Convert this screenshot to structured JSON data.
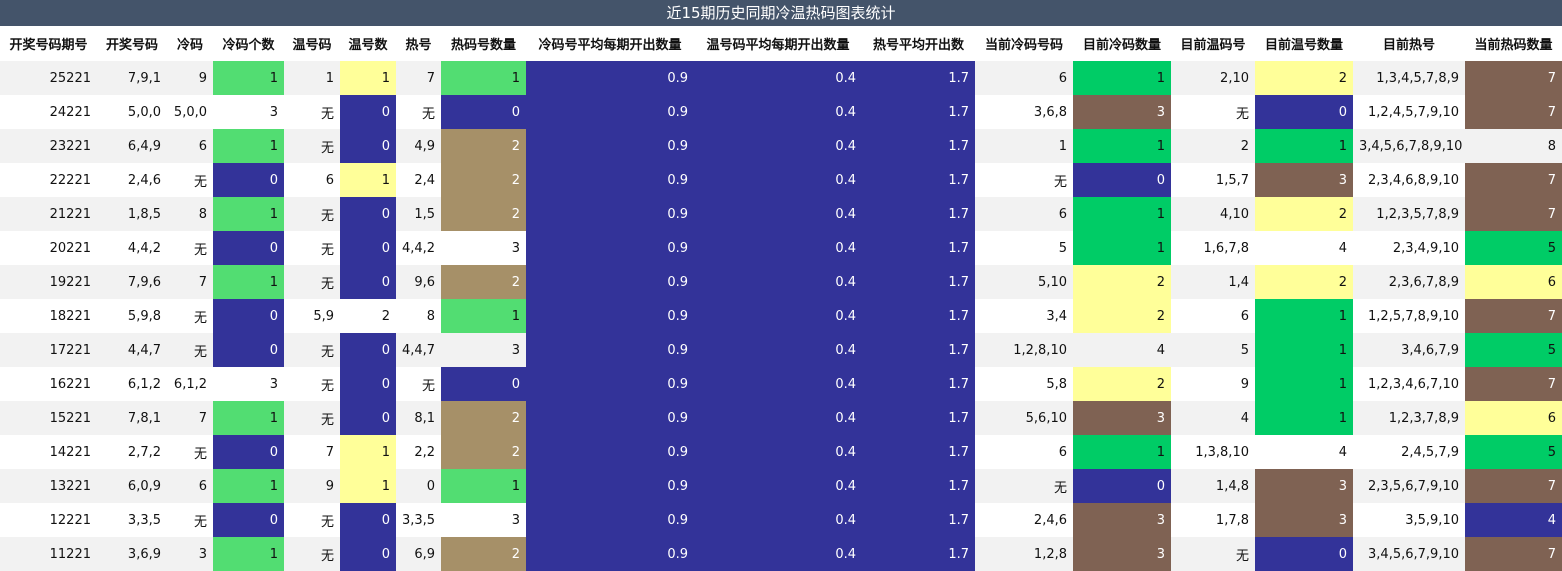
{
  "title": "近15期历史同期冷温热码图表统计",
  "colors": {
    "title_bar": "#44546a",
    "green": "#52dd72",
    "bright_green": "#00cc66",
    "yellow": "#ffff99",
    "navy": "#333399",
    "tan": "#a69068",
    "brown": "#7f6253"
  },
  "columns": [
    "开奖号码期号",
    "开奖号码",
    "冷码",
    "冷码个数",
    "温号码",
    "温号数",
    "热号",
    "热码号数量",
    "冷码号平均每期开出数量",
    "温号码平均每期开出数量",
    "热号平均开出数",
    "当前冷码号码",
    "目前冷码数量",
    "目前温码号",
    "目前温号数量",
    "目前热号",
    "当前热码数量"
  ],
  "rows": [
    {
      "cells": [
        "25221",
        "7,9,1",
        "9",
        "1",
        "1",
        "1",
        "7",
        "1",
        "0.9",
        "0.4",
        "1.7",
        "6",
        "1",
        "2,10",
        "2",
        "1,3,4,5,7,8,9",
        "7"
      ],
      "styles": {
        "3": "green",
        "5": "yellow",
        "7": "green",
        "12": "bright",
        "14": "yellow",
        "16": "brown"
      }
    },
    {
      "cells": [
        "24221",
        "5,0,0",
        "5,0,0",
        "3",
        "无",
        "0",
        "无",
        "0",
        "0.9",
        "0.4",
        "1.7",
        "3,6,8",
        "3",
        "无",
        "0",
        "1,2,4,5,7,9,10",
        "7"
      ],
      "styles": {
        "5": "navy",
        "7": "navy",
        "12": "brown",
        "14": "navy",
        "16": "brown"
      }
    },
    {
      "cells": [
        "23221",
        "6,4,9",
        "6",
        "1",
        "无",
        "0",
        "4,9",
        "2",
        "0.9",
        "0.4",
        "1.7",
        "1",
        "1",
        "2",
        "1",
        "3,4,5,6,7,8,9,10",
        "8"
      ],
      "styles": {
        "3": "green",
        "5": "navy",
        "7": "tan",
        "12": "bright",
        "14": "bright"
      }
    },
    {
      "cells": [
        "22221",
        "2,4,6",
        "无",
        "0",
        "6",
        "1",
        "2,4",
        "2",
        "0.9",
        "0.4",
        "1.7",
        "无",
        "0",
        "1,5,7",
        "3",
        "2,3,4,6,8,9,10",
        "7"
      ],
      "styles": {
        "3": "navy",
        "5": "yellow",
        "7": "tan",
        "12": "navy",
        "14": "brown",
        "16": "brown"
      }
    },
    {
      "cells": [
        "21221",
        "1,8,5",
        "8",
        "1",
        "无",
        "0",
        "1,5",
        "2",
        "0.9",
        "0.4",
        "1.7",
        "6",
        "1",
        "4,10",
        "2",
        "1,2,3,5,7,8,9",
        "7"
      ],
      "styles": {
        "3": "green",
        "5": "navy",
        "7": "tan",
        "12": "bright",
        "14": "yellow",
        "16": "brown"
      }
    },
    {
      "cells": [
        "20221",
        "4,4,2",
        "无",
        "0",
        "无",
        "0",
        "4,4,2",
        "3",
        "0.9",
        "0.4",
        "1.7",
        "5",
        "1",
        "1,6,7,8",
        "4",
        "2,3,4,9,10",
        "5"
      ],
      "styles": {
        "3": "navy",
        "5": "navy",
        "12": "bright",
        "16": "bright"
      }
    },
    {
      "cells": [
        "19221",
        "7,9,6",
        "7",
        "1",
        "无",
        "0",
        "9,6",
        "2",
        "0.9",
        "0.4",
        "1.7",
        "5,10",
        "2",
        "1,4",
        "2",
        "2,3,6,7,8,9",
        "6"
      ],
      "styles": {
        "3": "green",
        "5": "navy",
        "7": "tan",
        "12": "yellow",
        "14": "yellow",
        "16": "yellow"
      }
    },
    {
      "cells": [
        "18221",
        "5,9,8",
        "无",
        "0",
        "5,9",
        "2",
        "8",
        "1",
        "0.9",
        "0.4",
        "1.7",
        "3,4",
        "2",
        "6",
        "1",
        "1,2,5,7,8,9,10",
        "7"
      ],
      "styles": {
        "3": "navy",
        "7": "green",
        "12": "yellow",
        "14": "bright",
        "16": "brown"
      }
    },
    {
      "cells": [
        "17221",
        "4,4,7",
        "无",
        "0",
        "无",
        "0",
        "4,4,7",
        "3",
        "0.9",
        "0.4",
        "1.7",
        "1,2,8,10",
        "4",
        "5",
        "1",
        "3,4,6,7,9",
        "5"
      ],
      "styles": {
        "3": "navy",
        "5": "navy",
        "14": "bright",
        "16": "bright"
      }
    },
    {
      "cells": [
        "16221",
        "6,1,2",
        "6,1,2",
        "3",
        "无",
        "0",
        "无",
        "0",
        "0.9",
        "0.4",
        "1.7",
        "5,8",
        "2",
        "9",
        "1",
        "1,2,3,4,6,7,10",
        "7"
      ],
      "styles": {
        "5": "navy",
        "7": "navy",
        "12": "yellow",
        "14": "bright",
        "16": "brown"
      }
    },
    {
      "cells": [
        "15221",
        "7,8,1",
        "7",
        "1",
        "无",
        "0",
        "8,1",
        "2",
        "0.9",
        "0.4",
        "1.7",
        "5,6,10",
        "3",
        "4",
        "1",
        "1,2,3,7,8,9",
        "6"
      ],
      "styles": {
        "3": "green",
        "5": "navy",
        "7": "tan",
        "12": "brown",
        "14": "bright",
        "16": "yellow"
      }
    },
    {
      "cells": [
        "14221",
        "2,7,2",
        "无",
        "0",
        "7",
        "1",
        "2,2",
        "2",
        "0.9",
        "0.4",
        "1.7",
        "6",
        "1",
        "1,3,8,10",
        "4",
        "2,4,5,7,9",
        "5"
      ],
      "styles": {
        "3": "navy",
        "5": "yellow",
        "7": "tan",
        "12": "bright",
        "16": "bright"
      }
    },
    {
      "cells": [
        "13221",
        "6,0,9",
        "6",
        "1",
        "9",
        "1",
        "0",
        "1",
        "0.9",
        "0.4",
        "1.7",
        "无",
        "0",
        "1,4,8",
        "3",
        "2,3,5,6,7,9,10",
        "7"
      ],
      "styles": {
        "3": "green",
        "5": "yellow",
        "7": "green",
        "12": "navy",
        "14": "brown",
        "16": "brown"
      }
    },
    {
      "cells": [
        "12221",
        "3,3,5",
        "无",
        "0",
        "无",
        "0",
        "3,3,5",
        "3",
        "0.9",
        "0.4",
        "1.7",
        "2,4,6",
        "3",
        "1,7,8",
        "3",
        "3,5,9,10",
        "4"
      ],
      "styles": {
        "3": "navy",
        "5": "navy",
        "12": "brown",
        "14": "brown",
        "16": "navy"
      }
    },
    {
      "cells": [
        "11221",
        "3,6,9",
        "3",
        "1",
        "无",
        "0",
        "6,9",
        "2",
        "0.9",
        "0.4",
        "1.7",
        "1,2,8",
        "3",
        "无",
        "0",
        "3,4,5,6,7,9,10",
        "7"
      ],
      "styles": {
        "3": "green",
        "5": "navy",
        "7": "tan",
        "12": "brown",
        "14": "navy",
        "16": "brown"
      }
    }
  ]
}
